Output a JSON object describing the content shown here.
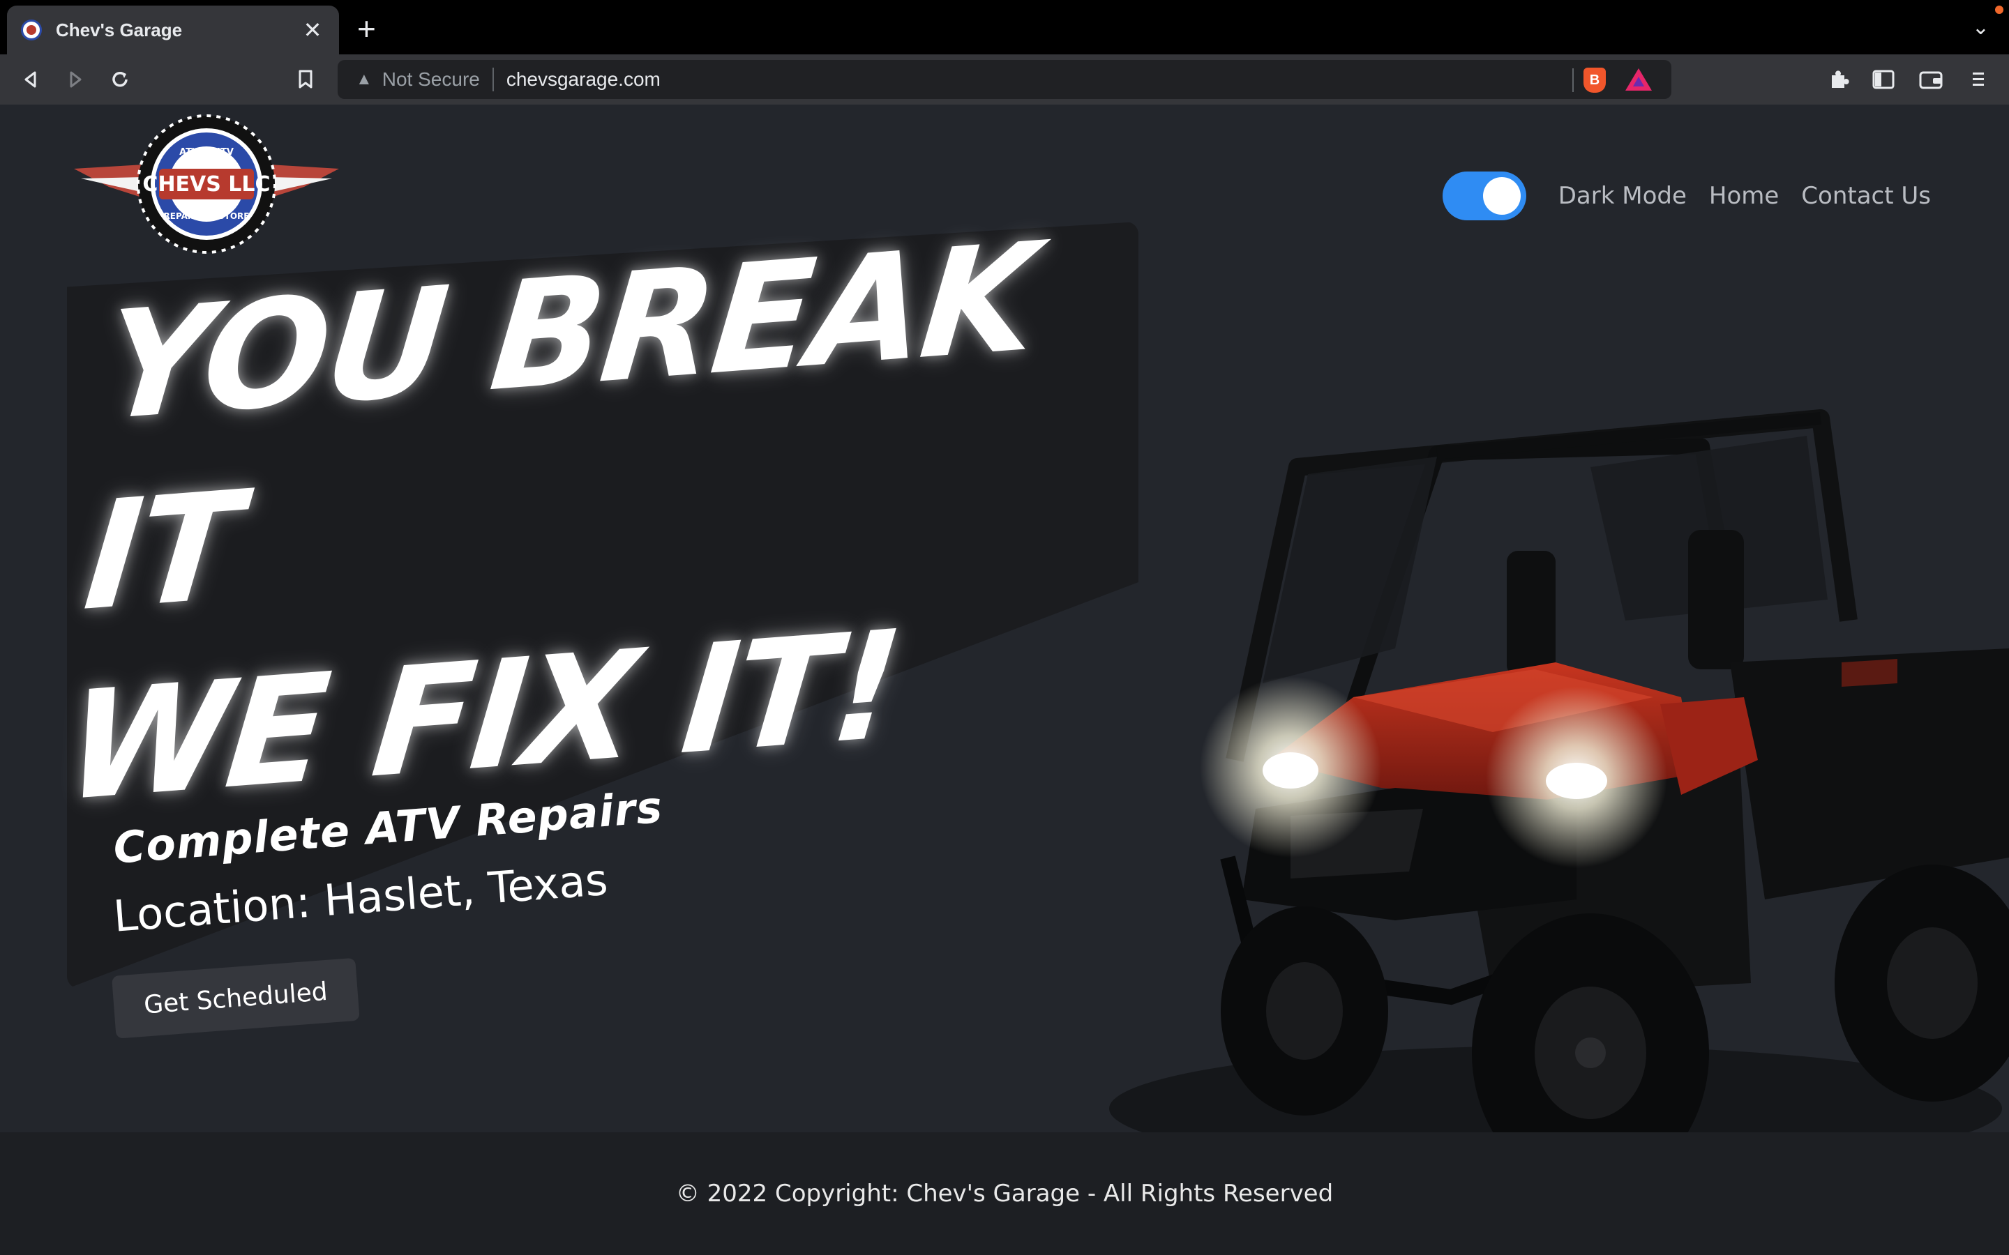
{
  "browser": {
    "tab_title": "Chev's Garage",
    "tab_close_icon": "close-icon",
    "new_tab_label": "+",
    "security_label": "Not Secure",
    "url": "chevsgarage.com"
  },
  "logo": {
    "top_text": "ATV & UTV",
    "main_text": "CHEVS LLC",
    "bottom_text": "REPAIR · RESTORE"
  },
  "nav": {
    "toggle_on": true,
    "dark_mode_label": "Dark Mode",
    "home_label": "Home",
    "contact_label": "Contact Us"
  },
  "hero": {
    "headline_line1": "YOU BREAK IT",
    "headline_line2": "WE FIX IT!",
    "subtitle": "Complete ATV Repairs",
    "location": "Location: Haslet, Texas",
    "cta_label": "Get Scheduled"
  },
  "footer": {
    "copyright": "© 2022 Copyright: Chev's Garage - All Rights Reserved"
  },
  "colors": {
    "page_bg": "#23262c",
    "panel_bg": "#1b1c1f",
    "toggle_accent": "#2f8cf3",
    "footer_bg": "#1d1f23",
    "vehicle_red": "#b62a1c"
  }
}
